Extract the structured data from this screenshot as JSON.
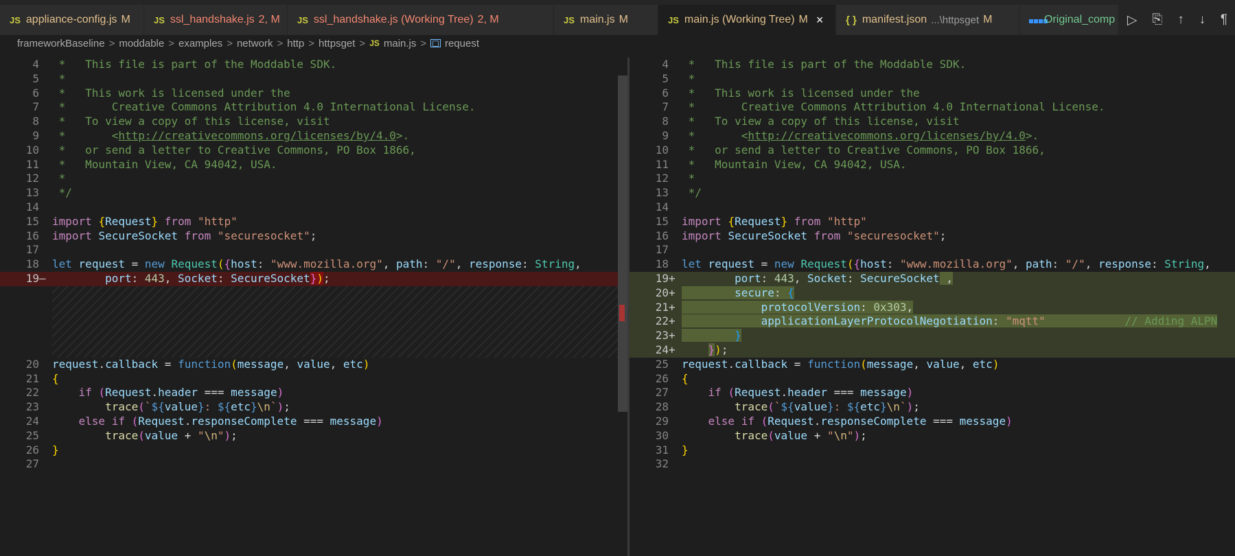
{
  "tabs": [
    {
      "name": "appliance-config.js",
      "status": "M",
      "kind": "js",
      "color": "#e2c08d"
    },
    {
      "name": "ssl_handshake.js",
      "status": "2, M",
      "kind": "js",
      "color": "#f48771"
    },
    {
      "name": "ssl_handshake.js (Working Tree)",
      "status": "2, M",
      "kind": "js",
      "color": "#f48771"
    },
    {
      "name": "main.js",
      "status": "M",
      "kind": "js",
      "color": "#e2c08d"
    },
    {
      "name": "main.js (Working Tree)",
      "status": "M",
      "kind": "js",
      "color": "#e2c08d",
      "active": true
    },
    {
      "name": "manifest.json",
      "desc": "...\\httpsget",
      "status": "M",
      "kind": "json",
      "color": "#e2c08d"
    },
    {
      "name": "Original_comp",
      "kind": "windows",
      "color": "#73c991"
    }
  ],
  "tab_icons": {
    "js": "JS",
    "json": "{ }",
    "close": "×"
  },
  "editor_actions": [
    "run-icon",
    "open-changes-icon",
    "previous-change-icon",
    "next-change-icon",
    "show-whitespace-icon"
  ],
  "editor_action_glyphs": [
    "▷",
    "⎘",
    "↑",
    "↓",
    "¶"
  ],
  "breadcrumbs": [
    "frameworkBaseline",
    "moddable",
    "examples",
    "network",
    "http",
    "httpsget",
    "main.js",
    "request"
  ],
  "breadcrumb_sep": ">",
  "colors": {
    "deleted_line": "#4b1818",
    "inserted_line": "#373d29",
    "modified_tab": "#e2c08d",
    "error_tab": "#f48771"
  },
  "diff": {
    "left": {
      "lines": [
        {
          "n": "4",
          "html": "<span class=\"c\"> *   This file is part of the Moddable SDK.</span>"
        },
        {
          "n": "5",
          "html": "<span class=\"c\"> *</span>"
        },
        {
          "n": "6",
          "html": "<span class=\"c\"> *   This work is licensed under the</span>"
        },
        {
          "n": "7",
          "html": "<span class=\"c\"> *       Creative Commons Attribution 4.0 International License.</span>"
        },
        {
          "n": "8",
          "html": "<span class=\"c\"> *   To view a copy of this license, visit</span>"
        },
        {
          "n": "9",
          "html": "<span class=\"c\"> *       &lt;</span><span class=\"cu\">http://creativecommons.org/licenses/by/4.0</span><span class=\"c\">&gt;.</span>"
        },
        {
          "n": "10",
          "html": "<span class=\"c\"> *   or send a letter to Creative Commons, PO Box 1866,</span>"
        },
        {
          "n": "11",
          "html": "<span class=\"c\"> *   Mountain View, CA 94042, USA.</span>"
        },
        {
          "n": "12",
          "html": "<span class=\"c\"> *</span>"
        },
        {
          "n": "13",
          "html": "<span class=\"c\"> */</span>"
        },
        {
          "n": "14",
          "html": ""
        },
        {
          "n": "15",
          "html": "<span class=\"k\">import</span> <span class=\"b1\">{</span><span class=\"v\">Request</span><span class=\"b1\">}</span> <span class=\"k\">from</span> <span class=\"s\">\"http\"</span>"
        },
        {
          "n": "16",
          "html": "<span class=\"k\">import</span> <span class=\"v\">SecureSocket</span> <span class=\"k\">from</span> <span class=\"s\">\"securesocket\"</span><span class=\"p\">;</span>"
        },
        {
          "n": "17",
          "html": ""
        },
        {
          "n": "18",
          "html": "<span class=\"kb\">let</span> <span class=\"v\">request</span> <span class=\"p\">=</span> <span class=\"kb\">new</span> <span class=\"t\">Request</span><span class=\"b1\">(</span><span class=\"b2\">{</span><span class=\"v\">host</span><span class=\"p\">: </span><span class=\"s\">\"www.mozilla.org\"</span><span class=\"p\">, </span><span class=\"v\">path</span><span class=\"p\">: </span><span class=\"s\">\"/\"</span><span class=\"p\">, </span><span class=\"v\">response</span><span class=\"p\">: </span><span class=\"t\">String</span><span class=\"p\">,</span>"
        },
        {
          "n": "19",
          "type": "del",
          "mark": "—",
          "html": "        <span class=\"v\">port</span><span class=\"p\">: </span><span class=\"n\">443</span><span class=\"p\">, </span><span class=\"v\">Socket</span><span class=\"p\">: </span><span class=\"v\">SecureSocket</span><span class=\"inline-del\"><span class=\"b2\">}</span><span class=\"b1\">)</span></span><span class=\"p\">;</span>"
        },
        {
          "filler": 5
        },
        {
          "n": "20",
          "html": "<span class=\"v\">request</span><span class=\"p\">.</span><span class=\"v\">callback</span> <span class=\"p\">=</span> <span class=\"kb\">function</span><span class=\"b1\">(</span><span class=\"v\">message</span><span class=\"p\">, </span><span class=\"v\">value</span><span class=\"p\">, </span><span class=\"v\">etc</span><span class=\"b1\">)</span>"
        },
        {
          "n": "21",
          "html": "<span class=\"b1\">{</span>"
        },
        {
          "n": "22",
          "html": "    <span class=\"k\">if</span> <span class=\"b2\">(</span><span class=\"v\">Request</span><span class=\"p\">.</span><span class=\"v\">header</span> <span class=\"p\">===</span> <span class=\"v\">message</span><span class=\"b2\">)</span>"
        },
        {
          "n": "23",
          "html": "        <span class=\"f\">trace</span><span class=\"b2\">(</span><span class=\"s\">`</span><span class=\"kb\">${</span><span class=\"v\">value</span><span class=\"kb\">}</span><span class=\"s\">: </span><span class=\"kb\">${</span><span class=\"v\">etc</span><span class=\"kb\">}</span><span class=\"esc\">\\n</span><span class=\"s\">`</span><span class=\"b2\">)</span><span class=\"p\">;</span>"
        },
        {
          "n": "24",
          "html": "    <span class=\"k\">else</span> <span class=\"k\">if</span> <span class=\"b2\">(</span><span class=\"v\">Request</span><span class=\"p\">.</span><span class=\"v\">responseComplete</span> <span class=\"p\">===</span> <span class=\"v\">message</span><span class=\"b2\">)</span>"
        },
        {
          "n": "25",
          "html": "        <span class=\"f\">trace</span><span class=\"b2\">(</span><span class=\"v\">value</span> <span class=\"p\">+</span> <span class=\"s\">\"</span><span class=\"esc\">\\n</span><span class=\"s\">\"</span><span class=\"b2\">)</span><span class=\"p\">;</span>"
        },
        {
          "n": "26",
          "html": "<span class=\"b1\">}</span>"
        },
        {
          "n": "27",
          "html": ""
        }
      ]
    },
    "right": {
      "lines": [
        {
          "n": "4",
          "html": "<span class=\"c\"> *   This file is part of the Moddable SDK.</span>"
        },
        {
          "n": "5",
          "html": "<span class=\"c\"> *</span>"
        },
        {
          "n": "6",
          "html": "<span class=\"c\"> *   This work is licensed under the</span>"
        },
        {
          "n": "7",
          "html": "<span class=\"c\"> *       Creative Commons Attribution 4.0 International License.</span>"
        },
        {
          "n": "8",
          "html": "<span class=\"c\"> *   To view a copy of this license, visit</span>"
        },
        {
          "n": "9",
          "html": "<span class=\"c\"> *       &lt;</span><span class=\"cu\">http://creativecommons.org/licenses/by/4.0</span><span class=\"c\">&gt;.</span>"
        },
        {
          "n": "10",
          "html": "<span class=\"c\"> *   or send a letter to Creative Commons, PO Box 1866,</span>"
        },
        {
          "n": "11",
          "html": "<span class=\"c\"> *   Mountain View, CA 94042, USA.</span>"
        },
        {
          "n": "12",
          "html": "<span class=\"c\"> *</span>"
        },
        {
          "n": "13",
          "html": "<span class=\"c\"> */</span>"
        },
        {
          "n": "14",
          "html": ""
        },
        {
          "n": "15",
          "html": "<span class=\"k\">import</span> <span class=\"b1\">{</span><span class=\"v\">Request</span><span class=\"b1\">}</span> <span class=\"k\">from</span> <span class=\"s\">\"http\"</span>"
        },
        {
          "n": "16",
          "html": "<span class=\"k\">import</span> <span class=\"v\">SecureSocket</span> <span class=\"k\">from</span> <span class=\"s\">\"securesocket\"</span><span class=\"p\">;</span>"
        },
        {
          "n": "17",
          "html": ""
        },
        {
          "n": "18",
          "html": "<span class=\"kb\">let</span> <span class=\"v\">request</span> <span class=\"p\">=</span> <span class=\"kb\">new</span> <span class=\"t\">Request</span><span class=\"b1\">(</span><span class=\"b2\">{</span><span class=\"v\">host</span><span class=\"p\">: </span><span class=\"s\">\"www.mozilla.org\"</span><span class=\"p\">, </span><span class=\"v\">path</span><span class=\"p\">: </span><span class=\"s\">\"/\"</span><span class=\"p\">, </span><span class=\"v\">response</span><span class=\"p\">: </span><span class=\"t\">String</span><span class=\"p\">,</span>"
        },
        {
          "n": "19",
          "type": "ins",
          "mark": "+",
          "html": "        <span class=\"v\">port</span><span class=\"p\">: </span><span class=\"n\">443</span><span class=\"p\">, </span><span class=\"v\">Socket</span><span class=\"p\">: </span><span class=\"v\">SecureSocket</span><span class=\"inline-ins\"> <span class=\"p\">,</span></span>"
        },
        {
          "n": "20",
          "type": "ins",
          "mark": "+",
          "html": "<span class=\"inline-ins\">        <span class=\"v\">secure</span><span class=\"p\">: </span><span class=\"b3\">{</span></span>"
        },
        {
          "n": "21",
          "type": "ins",
          "mark": "+",
          "html": "<span class=\"inline-ins\">            <span class=\"v\">protocolVersion</span><span class=\"p\">: </span><span class=\"n\">0x303</span><span class=\"p\">,</span></span>"
        },
        {
          "n": "22",
          "type": "ins",
          "mark": "+",
          "html": "<span class=\"inline-ins\">            <span class=\"v\">applicationLayerProtocolNegotiation</span><span class=\"p\">: </span><span class=\"s\">\"mqtt\"</span>            <span class=\"c\">// Adding ALPN</span></span>"
        },
        {
          "n": "23",
          "type": "ins",
          "mark": "+",
          "html": "<span class=\"inline-ins\">        <span class=\"b3\">}</span></span>"
        },
        {
          "n": "24",
          "type": "ins",
          "mark": "+",
          "html": "    <span class=\"inline-ins\"><span class=\"b2\">}</span></span><span class=\"b1\">)</span><span class=\"p\">;</span>"
        },
        {
          "n": "25",
          "html": "<span class=\"v\">request</span><span class=\"p\">.</span><span class=\"v\">callback</span> <span class=\"p\">=</span> <span class=\"kb\">function</span><span class=\"b1\">(</span><span class=\"v\">message</span><span class=\"p\">, </span><span class=\"v\">value</span><span class=\"p\">, </span><span class=\"v\">etc</span><span class=\"b1\">)</span>"
        },
        {
          "n": "26",
          "html": "<span class=\"b1\">{</span>"
        },
        {
          "n": "27",
          "html": "    <span class=\"k\">if</span> <span class=\"b2\">(</span><span class=\"v\">Request</span><span class=\"p\">.</span><span class=\"v\">header</span> <span class=\"p\">===</span> <span class=\"v\">message</span><span class=\"b2\">)</span>"
        },
        {
          "n": "28",
          "html": "        <span class=\"f\">trace</span><span class=\"b2\">(</span><span class=\"s\">`</span><span class=\"kb\">${</span><span class=\"v\">value</span><span class=\"kb\">}</span><span class=\"s\">: </span><span class=\"kb\">${</span><span class=\"v\">etc</span><span class=\"kb\">}</span><span class=\"esc\">\\n</span><span class=\"s\">`</span><span class=\"b2\">)</span><span class=\"p\">;</span>"
        },
        {
          "n": "29",
          "html": "    <span class=\"k\">else</span> <span class=\"k\">if</span> <span class=\"b2\">(</span><span class=\"v\">Request</span><span class=\"p\">.</span><span class=\"v\">responseComplete</span> <span class=\"p\">===</span> <span class=\"v\">message</span><span class=\"b2\">)</span>"
        },
        {
          "n": "30",
          "html": "        <span class=\"f\">trace</span><span class=\"b2\">(</span><span class=\"v\">value</span> <span class=\"p\">+</span> <span class=\"s\">\"</span><span class=\"esc\">\\n</span><span class=\"s\">\"</span><span class=\"b2\">)</span><span class=\"p\">;</span>"
        },
        {
          "n": "31",
          "html": "<span class=\"b1\">}</span>"
        },
        {
          "n": "32",
          "html": ""
        }
      ]
    }
  }
}
